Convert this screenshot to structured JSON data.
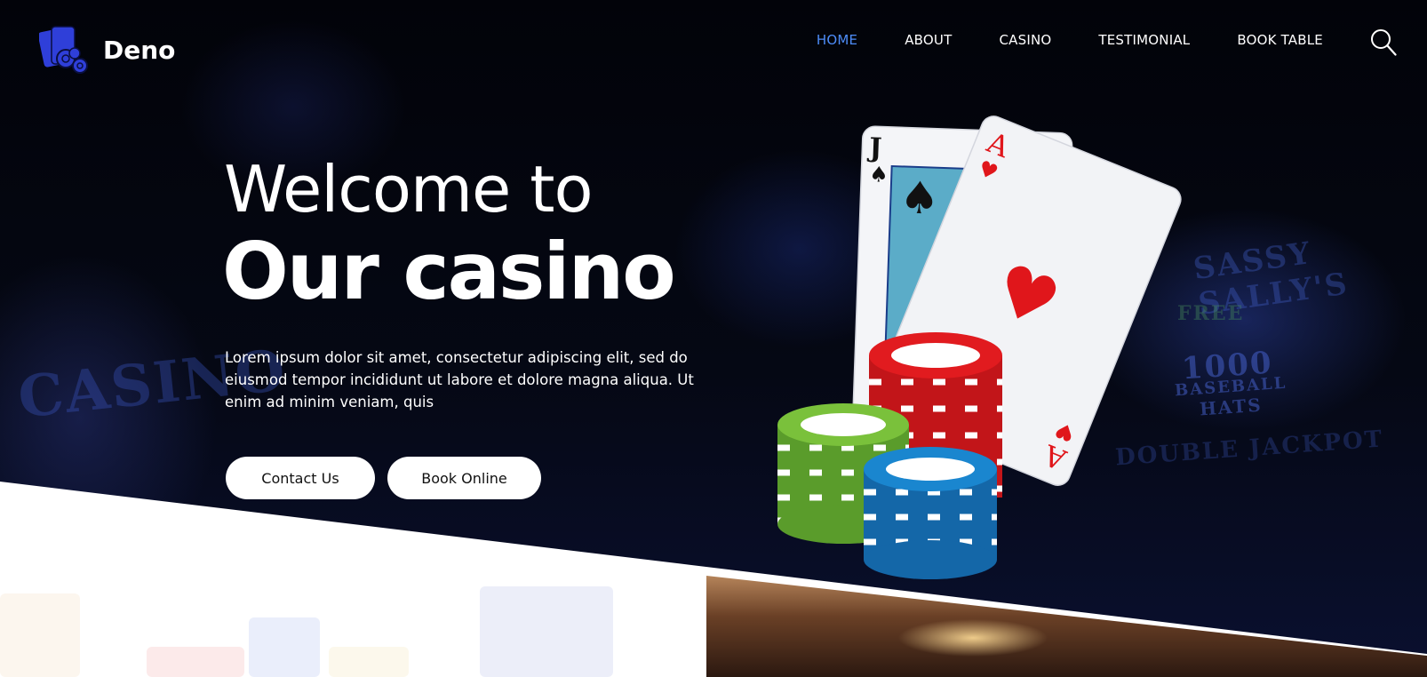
{
  "brand": {
    "name": "Deno",
    "logo_icon": "cards-and-chips-icon",
    "accent": "#2f3fd9"
  },
  "nav": {
    "items": [
      {
        "label": "HOME",
        "active": true
      },
      {
        "label": "ABOUT",
        "active": false
      },
      {
        "label": "CASINO",
        "active": false
      },
      {
        "label": "TESTIMONIAL",
        "active": false
      },
      {
        "label": "BOOK TABLE",
        "active": false
      }
    ],
    "active_color": "#4d8cf7",
    "search_icon": "search-icon"
  },
  "hero": {
    "title_line1": "Welcome to",
    "title_line2": "Our casino",
    "description": "Lorem ipsum dolor sit amet, consectetur adipiscing elit, sed do eiusmod tempor incididunt ut labore et dolore magna aliqua. Ut enim ad minim veniam, quis",
    "buttons": {
      "contact": "Contact Us",
      "book": "Book Online"
    }
  },
  "illustration": {
    "cards": [
      {
        "rank": "J",
        "suit": "♠",
        "color": "#111111"
      },
      {
        "rank": "A",
        "suit": "♥",
        "color": "#e0161b"
      }
    ],
    "chip_stacks": [
      {
        "color": "#7ac13b"
      },
      {
        "color": "#e11b1f"
      },
      {
        "color": "#1a86cf"
      }
    ]
  },
  "background": {
    "neon_signs": [
      "CASINO",
      "1000",
      "BASEBALL",
      "HATS",
      "DOUBLE JACKPOT",
      "SASSY SALLY'S",
      "FREE"
    ]
  }
}
